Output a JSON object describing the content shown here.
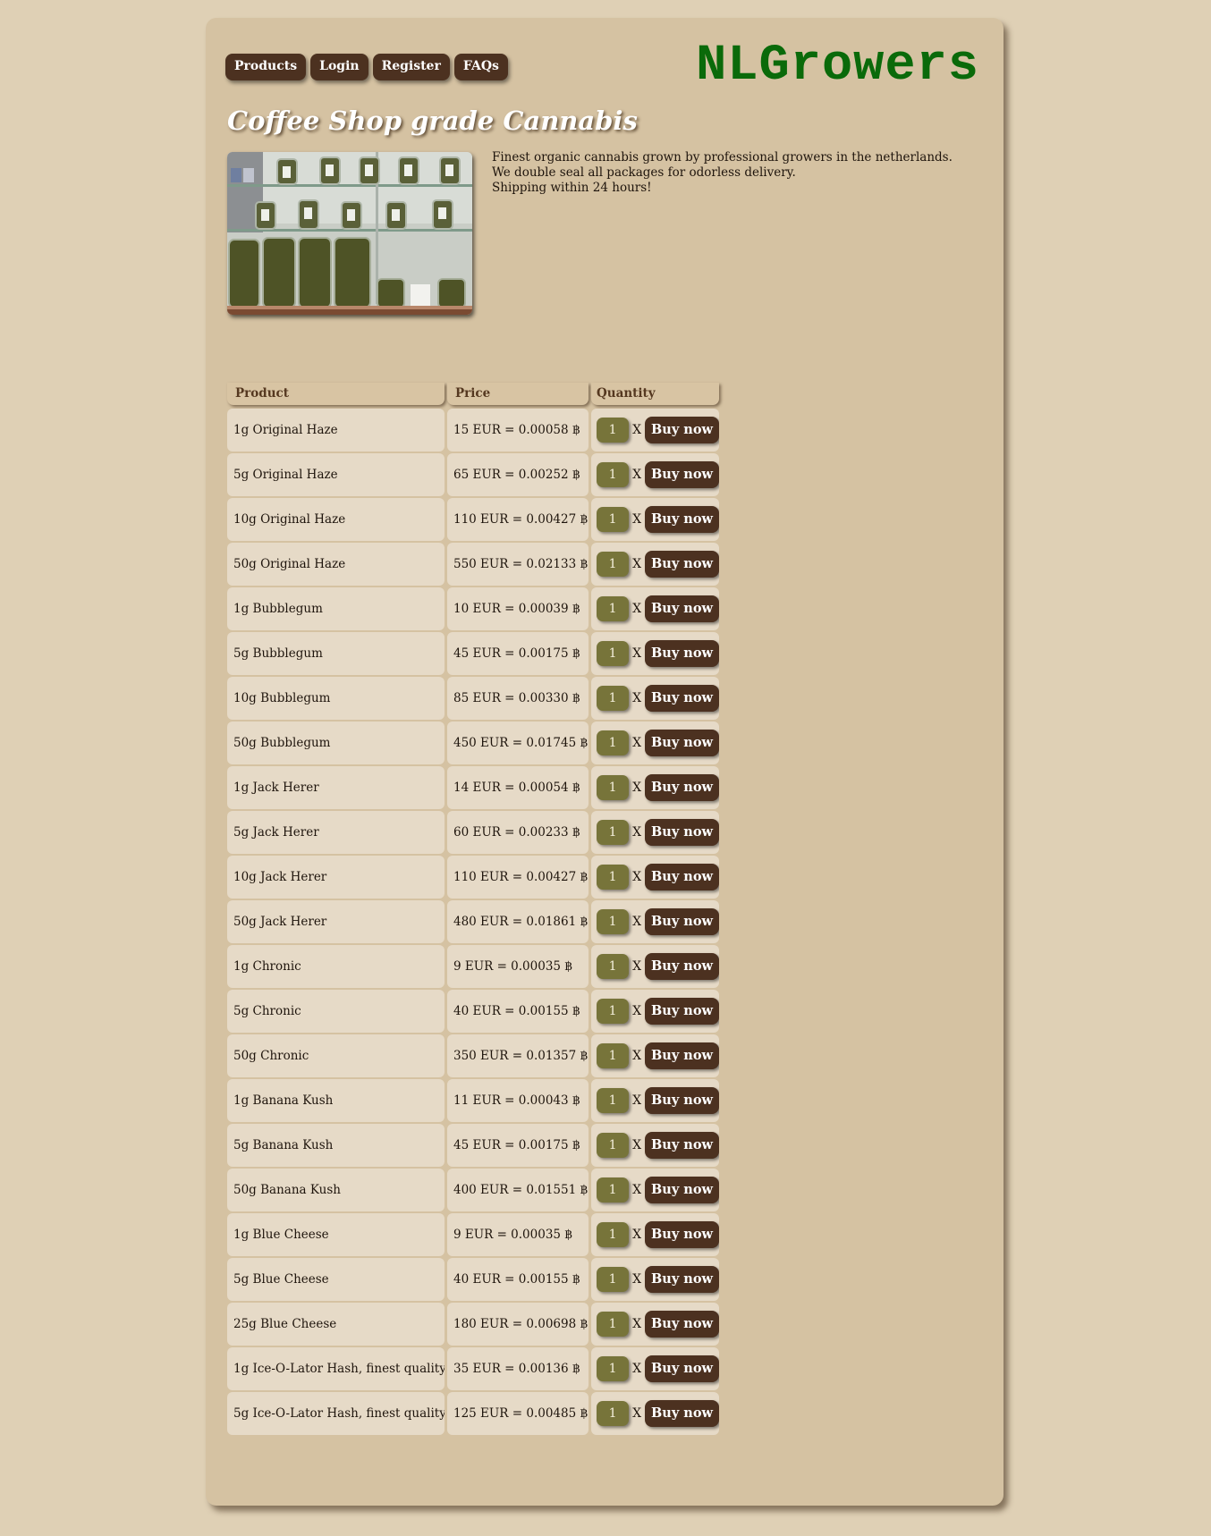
{
  "nav": {
    "items": [
      "Products",
      "Login",
      "Register",
      "FAQs"
    ]
  },
  "logo": "NLGrowers",
  "headline": "Coffee Shop grade Cannabis",
  "intro": [
    "Finest organic cannabis grown by professional growers in the netherlands.",
    "We double seal all packages for odorless delivery.",
    "Shipping within 24 hours!"
  ],
  "table": {
    "headers": [
      "Product",
      "Price",
      "Quantity"
    ],
    "multiply_sign": "X",
    "buy_label": "Buy now",
    "rows": [
      {
        "product": "1g Original Haze",
        "price": "15 EUR = 0.00058 ฿",
        "qty": "1"
      },
      {
        "product": "5g Original Haze",
        "price": "65 EUR = 0.00252 ฿",
        "qty": "1"
      },
      {
        "product": "10g Original Haze",
        "price": "110 EUR = 0.00427 ฿",
        "qty": "1"
      },
      {
        "product": "50g Original Haze",
        "price": "550 EUR = 0.02133 ฿",
        "qty": "1"
      },
      {
        "product": "1g Bubblegum",
        "price": "10 EUR = 0.00039 ฿",
        "qty": "1"
      },
      {
        "product": "5g Bubblegum",
        "price": "45 EUR = 0.00175 ฿",
        "qty": "1"
      },
      {
        "product": "10g Bubblegum",
        "price": "85 EUR = 0.00330 ฿",
        "qty": "1"
      },
      {
        "product": "50g Bubblegum",
        "price": "450 EUR = 0.01745 ฿",
        "qty": "1"
      },
      {
        "product": "1g Jack Herer",
        "price": "14 EUR = 0.00054 ฿",
        "qty": "1"
      },
      {
        "product": "5g Jack Herer",
        "price": "60 EUR = 0.00233 ฿",
        "qty": "1"
      },
      {
        "product": "10g Jack Herer",
        "price": "110 EUR = 0.00427 ฿",
        "qty": "1"
      },
      {
        "product": "50g Jack Herer",
        "price": "480 EUR = 0.01861 ฿",
        "qty": "1"
      },
      {
        "product": "1g Chronic",
        "price": "9 EUR = 0.00035 ฿",
        "qty": "1"
      },
      {
        "product": "5g Chronic",
        "price": "40 EUR = 0.00155 ฿",
        "qty": "1"
      },
      {
        "product": "50g Chronic",
        "price": "350 EUR = 0.01357 ฿",
        "qty": "1"
      },
      {
        "product": "1g Banana Kush",
        "price": "11 EUR = 0.00043 ฿",
        "qty": "1"
      },
      {
        "product": "5g Banana Kush",
        "price": "45 EUR = 0.00175 ฿",
        "qty": "1"
      },
      {
        "product": "50g Banana Kush",
        "price": "400 EUR = 0.01551 ฿",
        "qty": "1"
      },
      {
        "product": "1g Blue Cheese",
        "price": "9 EUR = 0.00035 ฿",
        "qty": "1"
      },
      {
        "product": "5g Blue Cheese",
        "price": "40 EUR = 0.00155 ฿",
        "qty": "1"
      },
      {
        "product": "25g Blue Cheese",
        "price": "180 EUR = 0.00698 ฿",
        "qty": "1"
      },
      {
        "product": "1g Ice-O-Lator Hash, finest quality",
        "price": "35 EUR = 0.00136 ฿",
        "qty": "1"
      },
      {
        "product": "5g Ice-O-Lator Hash, finest quality",
        "price": "125 EUR = 0.00485 ฿",
        "qty": "1"
      }
    ]
  },
  "colors": {
    "background": "#dfd0b5",
    "panel": "#d5c2a2",
    "button": "#4c3120",
    "quantity_box": "#77743a",
    "logo": "#0a6a0a",
    "cell": "#e6dac7"
  }
}
